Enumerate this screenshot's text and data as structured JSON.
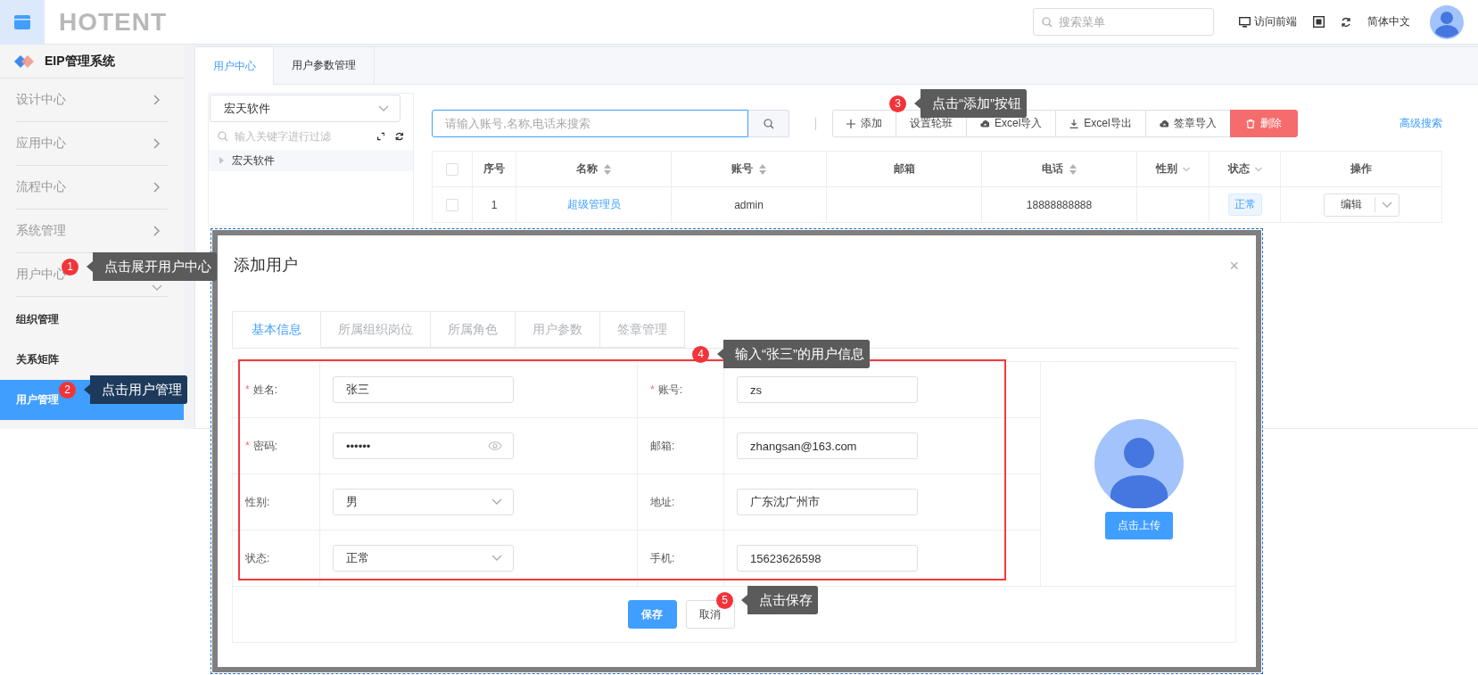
{
  "header": {
    "logo": "HOTENT",
    "search_placeholder": "搜索菜单",
    "frontend_link": "访问前端",
    "language": "简体中文"
  },
  "sidebar": {
    "title": "EIP管理系统",
    "items": [
      {
        "label": "设计中心",
        "expanded": false,
        "selected": false
      },
      {
        "label": "应用中心",
        "expanded": false,
        "selected": false
      },
      {
        "label": "流程中心",
        "expanded": false,
        "selected": false
      },
      {
        "label": "系统管理",
        "expanded": false,
        "selected": false
      },
      {
        "label": "用户中心",
        "expanded": true,
        "selected": false,
        "children": [
          {
            "label": "组织管理",
            "selected": false
          },
          {
            "label": "关系矩阵",
            "selected": false
          },
          {
            "label": "用户管理",
            "selected": true
          }
        ]
      }
    ]
  },
  "tabs": [
    {
      "label": "用户中心",
      "selected": true
    },
    {
      "label": "用户参数管理",
      "selected": false
    }
  ],
  "org_tree": {
    "select_value": "宏天软件",
    "filter_placeholder": "输入关键字进行过滤",
    "nodes": [
      {
        "label": "宏天软件",
        "expanded": false
      }
    ]
  },
  "toolbar": {
    "search_placeholder": "请输入账号,名称,电话来搜索",
    "buttons": [
      {
        "label": "添加",
        "kind": "add"
      },
      {
        "label": "设置轮班",
        "kind": "plain"
      },
      {
        "label": "Excel导入",
        "kind": "upload"
      },
      {
        "label": "Excel导出",
        "kind": "download"
      },
      {
        "label": "签章导入",
        "kind": "upload"
      },
      {
        "label": "删除",
        "kind": "danger"
      }
    ],
    "advanced_link": "高级搜索"
  },
  "table": {
    "columns": [
      {
        "kind": "checkbox",
        "checked": false
      },
      {
        "kind": "text",
        "label": "序号"
      },
      {
        "kind": "link",
        "label": "名称",
        "sortable": true
      },
      {
        "kind": "text",
        "label": "账号",
        "sortable": true
      },
      {
        "kind": "text",
        "label": "邮箱"
      },
      {
        "kind": "text",
        "label": "电话",
        "sortable": true
      },
      {
        "kind": "text",
        "label": "性别",
        "filterable": true
      },
      {
        "kind": "tag",
        "label": "状态",
        "filterable": true
      },
      {
        "kind": "action",
        "label": "操作"
      }
    ],
    "rows": [
      {
        "checked": false,
        "cells": [
          "",
          "1",
          "超级管理员",
          "admin",
          "",
          "18888888888",
          "",
          "正常",
          "编辑"
        ]
      }
    ]
  },
  "dialog": {
    "title": "添加用户",
    "close": "×",
    "tabs": [
      {
        "label": "基本信息",
        "selected": true
      },
      {
        "label": "所属组织岗位",
        "selected": false
      },
      {
        "label": "所属角色",
        "selected": false
      },
      {
        "label": "用户参数",
        "selected": false
      },
      {
        "label": "签章管理",
        "selected": false
      }
    ],
    "fields": [
      {
        "label": "姓名:",
        "required_mark": "*",
        "kind": "text",
        "value": "张三"
      },
      {
        "label": "账号:",
        "required_mark": "*",
        "kind": "text",
        "value": "zs"
      },
      {
        "label": "密码:",
        "required_mark": "*",
        "kind": "password",
        "value": "••••••"
      },
      {
        "label": "邮箱:",
        "kind": "text",
        "value": "zhangsan@163.com"
      },
      {
        "label": "性别:",
        "kind": "select",
        "value": "男"
      },
      {
        "label": "地址:",
        "kind": "text",
        "value": "广东沈广州市"
      },
      {
        "label": "状态:",
        "kind": "select",
        "value": "正常"
      },
      {
        "label": "手机:",
        "kind": "text",
        "value": "15623626598"
      }
    ],
    "upload_button": "点击上传",
    "buttons": [
      {
        "label": "保存",
        "kind": "primary"
      },
      {
        "label": "取消",
        "kind": "plain"
      }
    ]
  },
  "callouts": [
    {
      "number": "1",
      "text": "点击展开用户中心",
      "color": "#5b5b5b"
    },
    {
      "number": "2",
      "text": "点击用户管理",
      "color": "#1d3a5c"
    },
    {
      "number": "3",
      "text": "点击“添加”按钮",
      "color": "#5b5b5b"
    },
    {
      "number": "4",
      "text": "输入“张三”的用户信息",
      "color": "#5b5b5b"
    },
    {
      "number": "5",
      "text": "点击保存",
      "color": "#5b5b5b"
    }
  ]
}
